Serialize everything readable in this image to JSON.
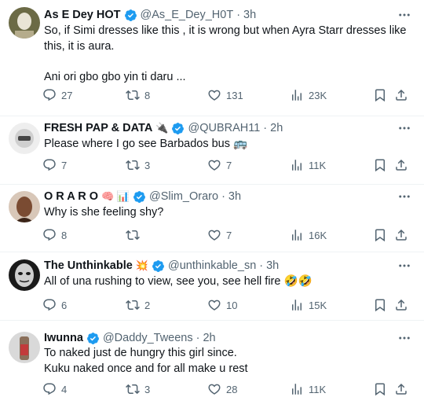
{
  "tweets": [
    {
      "name": "As E Dey HOT",
      "name_emoji": "",
      "handle": "@As_E_Dey_H0T",
      "time": "3h",
      "lines": [
        "So, if Simi dresses like this , it is wrong but when Ayra Starr dresses like",
        "this, it is aura.",
        "",
        "Ani ori gbo gbo yin ti daru ..."
      ],
      "replies": "27",
      "retweets": "8",
      "likes": "131",
      "views": "23K",
      "avatar_color": "#6b6a45"
    },
    {
      "name": "FRESH PAP & DATA",
      "name_emoji": "🔌",
      "handle": "@QUBRAH11",
      "time": "2h",
      "lines": [
        "Please where I go see Barbados bus 🚌"
      ],
      "replies": "7",
      "retweets": "3",
      "likes": "7",
      "views": "11K",
      "avatar_color": "#d9d9d9"
    },
    {
      "name": "O R A R O",
      "name_emoji": "🧠 📊",
      "handle": "@Slim_Oraro",
      "time": "3h",
      "lines": [
        "Why is she feeling shy?"
      ],
      "replies": "8",
      "retweets": "",
      "likes": "7",
      "views": "16K",
      "avatar_color": "#7a4b32"
    },
    {
      "name": "The Unthinkable",
      "name_emoji": "💥",
      "handle": "@unthinkable_sn",
      "time": "3h",
      "lines": [
        "All of una rushing to view, see you, see hell fire 🤣🤣"
      ],
      "replies": "6",
      "retweets": "2",
      "likes": "10",
      "views": "15K",
      "avatar_color": "#1a1a1a"
    },
    {
      "name": "Iwunna",
      "name_emoji": "",
      "handle": "@Daddy_Tweens",
      "time": "2h",
      "lines": [
        "To naked just de hungry this girl since.",
        "Kuku naked once and for all make u rest"
      ],
      "replies": "4",
      "retweets": "3",
      "likes": "28",
      "views": "11K",
      "avatar_color": "#a8a8a8"
    }
  ],
  "colors": {
    "verified": "#1d9bf0",
    "muted": "#536471",
    "text": "#0f1419",
    "divider": "#eff3f4"
  }
}
